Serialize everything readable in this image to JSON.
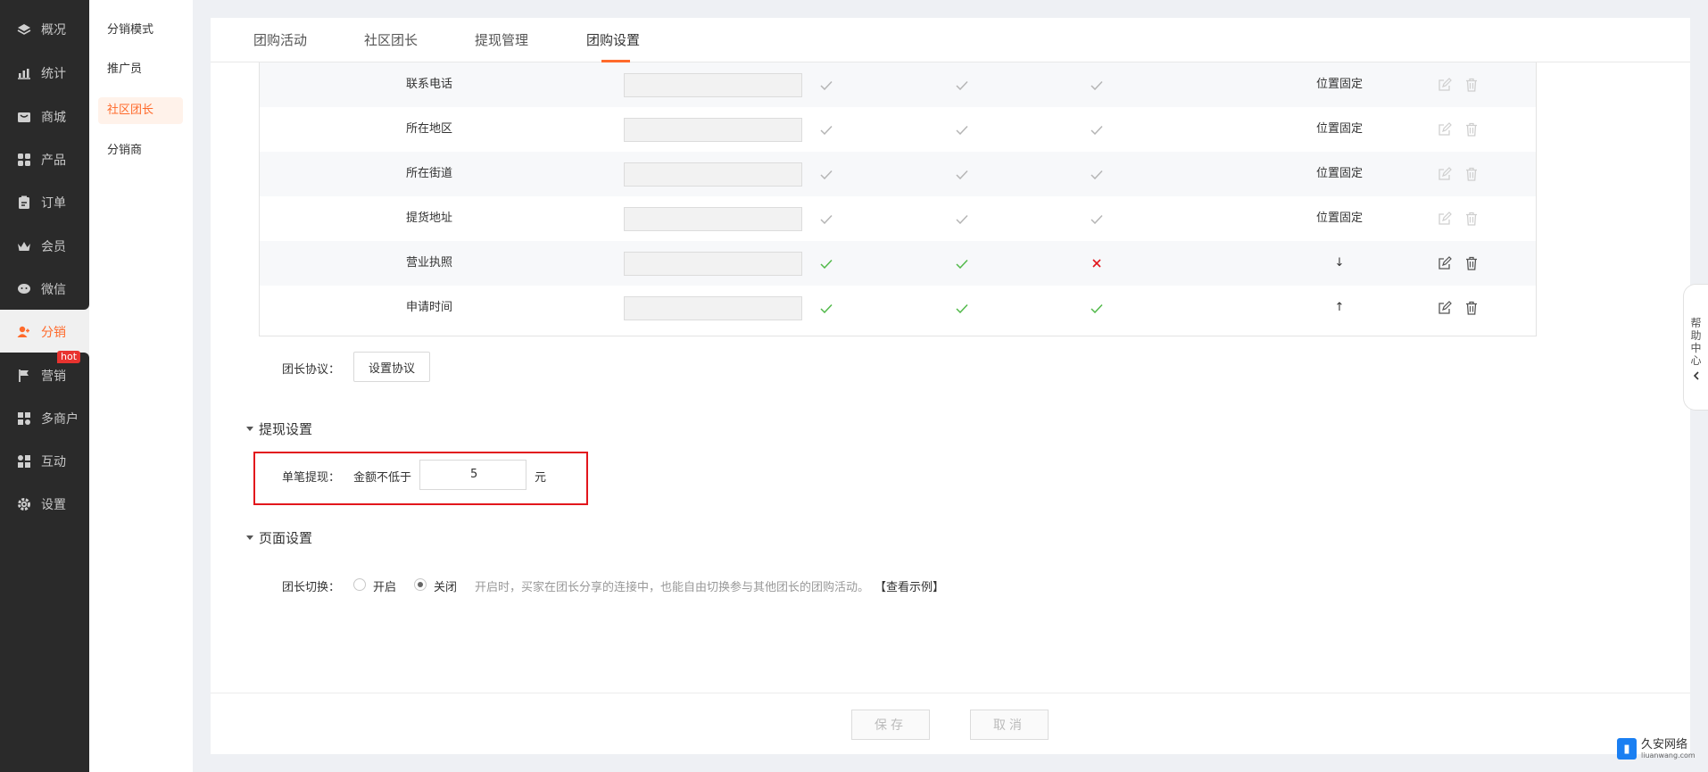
{
  "nav": {
    "items": [
      {
        "label": "概况",
        "icon": "layers-icon"
      },
      {
        "label": "统计",
        "icon": "chart-icon"
      },
      {
        "label": "商城",
        "icon": "store-icon"
      },
      {
        "label": "产品",
        "icon": "grid-icon"
      },
      {
        "label": "订单",
        "icon": "order-icon"
      },
      {
        "label": "会员",
        "icon": "crown-icon"
      },
      {
        "label": "微信",
        "icon": "wechat-icon"
      },
      {
        "label": "分销",
        "icon": "user-icon"
      },
      {
        "label": "营销",
        "icon": "flag-icon"
      },
      {
        "label": "多商户",
        "icon": "merchant-icon"
      },
      {
        "label": "互动",
        "icon": "interact-icon"
      },
      {
        "label": "设置",
        "icon": "gear-icon"
      }
    ],
    "hot_badge": "hot"
  },
  "subnav": {
    "items": [
      "分销模式",
      "推广员",
      "社区团长",
      "分销商"
    ]
  },
  "tabs": [
    "团购活动",
    "社区团长",
    "提现管理",
    "团购设置"
  ],
  "table": {
    "rows": [
      {
        "label": "联系电话",
        "c1": "✓",
        "c2": "✓",
        "c3": "✓",
        "order": "位置固定",
        "editable": false
      },
      {
        "label": "所在地区",
        "c1": "✓",
        "c2": "✓",
        "c3": "✓",
        "order": "位置固定",
        "editable": false
      },
      {
        "label": "所在街道",
        "c1": "✓",
        "c2": "✓",
        "c3": "✓",
        "order": "位置固定",
        "editable": false
      },
      {
        "label": "提货地址",
        "c1": "✓",
        "c2": "✓",
        "c3": "✓",
        "order": "位置固定",
        "editable": false
      },
      {
        "label": "营业执照",
        "c1": "✓",
        "c2": "✓",
        "c3": "✕",
        "order": "↓",
        "editable": true
      },
      {
        "label": "申请时间",
        "c1": "✓",
        "c2": "✓",
        "c3": "✓",
        "order": "↑",
        "editable": true
      }
    ]
  },
  "agreement": {
    "label": "团长协议：",
    "button": "设置协议"
  },
  "withdraw": {
    "title": "提现设置",
    "label": "单笔提现：",
    "prefix": "金额不低于",
    "value": "5",
    "unit": "元"
  },
  "page_settings": {
    "title": "页面设置",
    "label": "团长切换：",
    "opt_on": "开启",
    "opt_off": "关闭",
    "selected": "关闭",
    "hint": "开启时，买家在团长分享的连接中，也能自由切换参与其他团长的团购活动。",
    "example_link": "【查看示例】"
  },
  "footer": {
    "save": "保存",
    "cancel": "取消"
  },
  "help": [
    "帮",
    "助",
    "中",
    "心"
  ],
  "watermark": {
    "title": "久安网络",
    "sub": "liuanwang.com"
  },
  "colors": {
    "accent": "#ff6a2b",
    "check_green": "#52b94a",
    "check_gray": "#b5b5b5",
    "cross_red": "#e2161c",
    "highlight": "#e2161c"
  }
}
